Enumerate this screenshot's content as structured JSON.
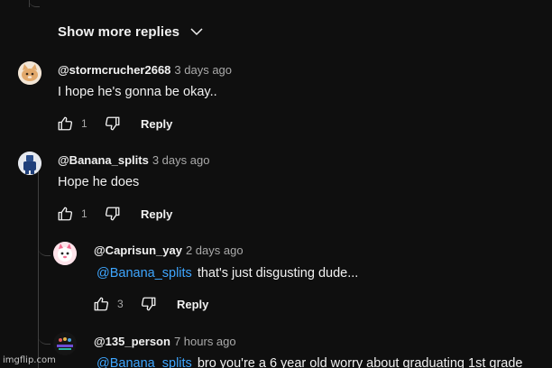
{
  "show_more": {
    "label": "Show more replies"
  },
  "comments": [
    {
      "handle": "@stormcrucher2668",
      "time": "3 days ago",
      "text": "I hope he's gonna be okay..",
      "likes": "1",
      "reply_label": "Reply",
      "avatar": "cat-avatar"
    },
    {
      "handle": "@Banana_splits",
      "time": "3 days ago",
      "text": "Hope he does",
      "likes": "1",
      "reply_label": "Reply",
      "avatar": "blue-figure-avatar"
    },
    {
      "handle": "@Caprisun_yay",
      "time": "2 days ago",
      "mention": "@Banana_splits",
      "text": "that's just disgusting dude...",
      "likes": "3",
      "reply_label": "Reply",
      "avatar": "pink-character-avatar"
    },
    {
      "handle": "@135_person",
      "time": "7 hours ago",
      "mention": "@Banana_splits",
      "text": "bro you're a 6 year old worry about graduating 1st grade",
      "avatar": "135-logo-avatar"
    }
  ],
  "watermark": "imgflip.com",
  "colors": {
    "background": "#0f0f0f",
    "mention": "#3ea6ff",
    "muted": "#aaaaaa",
    "thread_line": "#3f3f3f"
  },
  "icons": [
    "chevron-down-icon",
    "like-icon",
    "dislike-icon"
  ]
}
